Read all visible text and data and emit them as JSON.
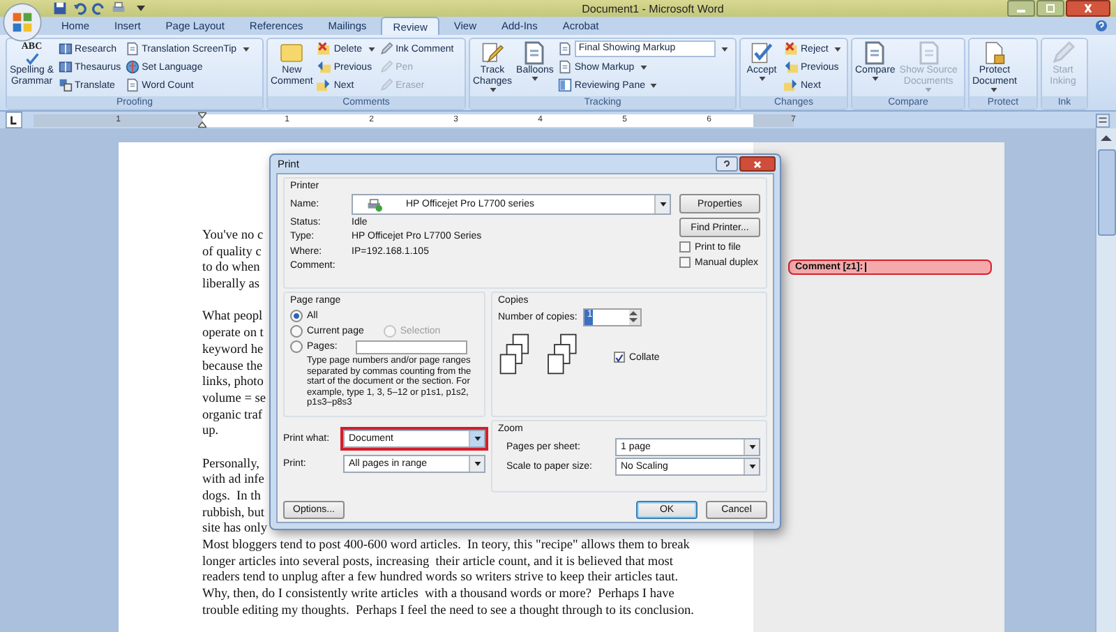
{
  "window": {
    "title": "Document1 - Microsoft Word"
  },
  "tabs": [
    {
      "label": "Home",
      "selected": false
    },
    {
      "label": "Insert",
      "selected": false
    },
    {
      "label": "Page Layout",
      "selected": false
    },
    {
      "label": "References",
      "selected": false
    },
    {
      "label": "Mailings",
      "selected": false
    },
    {
      "label": "Review",
      "selected": true
    },
    {
      "label": "View",
      "selected": false
    },
    {
      "label": "Add-Ins",
      "selected": false
    },
    {
      "label": "Acrobat",
      "selected": false
    }
  ],
  "ribbon": {
    "groups": [
      {
        "label": "Proofing",
        "columns": [
          {
            "kind": "large",
            "label": "Spelling &\nGrammar",
            "icon_text": "ABC",
            "dropdown": false,
            "disabled": false
          },
          {
            "kind": "stack",
            "items": [
              {
                "kind": "button",
                "label": "Research",
                "dropdown": false,
                "disabled": false
              },
              {
                "kind": "button",
                "label": "Thesaurus",
                "dropdown": false,
                "disabled": false
              },
              {
                "kind": "button",
                "label": "Translate",
                "dropdown": false,
                "disabled": false
              }
            ]
          },
          {
            "kind": "stack",
            "items": [
              {
                "kind": "button",
                "label": "Translation ScreenTip",
                "dropdown": true,
                "disabled": false
              },
              {
                "kind": "button",
                "label": "Set Language",
                "dropdown": false,
                "disabled": false
              },
              {
                "kind": "button",
                "label": "Word Count",
                "dropdown": false,
                "disabled": false
              }
            ]
          }
        ]
      },
      {
        "label": "Comments",
        "columns": [
          {
            "kind": "large",
            "label": "New\nComment",
            "dropdown": false,
            "disabled": false
          },
          {
            "kind": "stack",
            "items": [
              {
                "kind": "button",
                "label": "Delete",
                "dropdown": true,
                "disabled": false
              },
              {
                "kind": "button",
                "label": "Previous",
                "dropdown": false,
                "disabled": false
              },
              {
                "kind": "button",
                "label": "Next",
                "dropdown": false,
                "disabled": false
              }
            ]
          },
          {
            "kind": "stack",
            "items": [
              {
                "kind": "button",
                "label": "Ink Comment",
                "dropdown": false,
                "disabled": false
              },
              {
                "kind": "button",
                "label": "Pen",
                "dropdown": false,
                "disabled": true
              },
              {
                "kind": "button",
                "label": "Eraser",
                "dropdown": false,
                "disabled": true
              }
            ]
          }
        ]
      },
      {
        "label": "Tracking",
        "columns": [
          {
            "kind": "large",
            "label": "Track\nChanges",
            "dropdown": true,
            "disabled": false
          },
          {
            "kind": "large",
            "label": "Balloons",
            "dropdown": true,
            "disabled": false
          },
          {
            "kind": "stack",
            "items": [
              {
                "kind": "combo",
                "label": "Final Showing Markup",
                "dropdown": true,
                "disabled": false
              },
              {
                "kind": "button",
                "label": "Show Markup",
                "dropdown": true,
                "disabled": false
              },
              {
                "kind": "button",
                "label": "Reviewing Pane",
                "dropdown": true,
                "disabled": false
              }
            ]
          }
        ]
      },
      {
        "label": "Changes",
        "columns": [
          {
            "kind": "large",
            "label": "Accept",
            "dropdown": true,
            "disabled": false
          },
          {
            "kind": "stack",
            "items": [
              {
                "kind": "button",
                "label": "Reject",
                "dropdown": true,
                "disabled": false
              },
              {
                "kind": "button",
                "label": "Previous",
                "dropdown": false,
                "disabled": false
              },
              {
                "kind": "button",
                "label": "Next",
                "dropdown": false,
                "disabled": false
              }
            ]
          }
        ]
      },
      {
        "label": "Compare",
        "columns": [
          {
            "kind": "large",
            "label": "Compare",
            "dropdown": true,
            "disabled": false
          },
          {
            "kind": "large",
            "label": "Show Source\nDocuments",
            "dropdown": true,
            "disabled": true
          }
        ]
      },
      {
        "label": "Protect",
        "columns": [
          {
            "kind": "large",
            "label": "Protect\nDocument",
            "dropdown": true,
            "disabled": false
          }
        ]
      },
      {
        "label": "Ink",
        "columns": [
          {
            "kind": "large",
            "label": "Start\nInking",
            "dropdown": false,
            "disabled": true
          }
        ]
      }
    ]
  },
  "ruler": {
    "numbers": [
      "1",
      "1",
      "2",
      "3",
      "4",
      "5",
      "6",
      "7"
    ]
  },
  "document": {
    "paragraphs": [
      {
        "lines": [
          "You've no c",
          "of quality c",
          "to do when",
          "liberally as"
        ]
      },
      {
        "lines": [
          "What peopl",
          "operate on t",
          "keyword he",
          "because the",
          "links, photo",
          "volume = se",
          "organic traf",
          "up."
        ]
      },
      {
        "lines": [
          "Personally,",
          "with ad infe",
          "dogs.  In th",
          "rubbish, but",
          "site has only",
          "Most bloggers tend to post 400-600 word articles.  In teory, this \"recipe\" allows them to break",
          "longer articles into several posts, increasing  their article count, and it is believed that most",
          "readers tend to unplug after a few hundred words so writers strive to keep their articles taut.",
          "Why, then, do I consistently write articles  with a thousand words or more?  Perhaps I have",
          "trouble editing my thoughts.  Perhaps I feel the need to see a thought through to its conclusion."
        ]
      }
    ]
  },
  "comment": {
    "label": "Comment [z1]:"
  },
  "print_dialog": {
    "title": "Print",
    "printer": {
      "legend": "Printer",
      "name_label": "Name:",
      "name": "HP Officejet Pro L7700 series",
      "info": [
        {
          "label": "Status:",
          "value": "Idle"
        },
        {
          "label": "Type:",
          "value": "HP Officejet Pro L7700 Series"
        },
        {
          "label": "Where:",
          "value": "IP=192.168.1.105"
        },
        {
          "label": "Comment:"
        }
      ],
      "properties_button": "Properties",
      "find_printer_button": "Find Printer...",
      "options": [
        {
          "label": "Print to file",
          "checked": false
        },
        {
          "label": "Manual duplex",
          "checked": false
        }
      ]
    },
    "page_range": {
      "legend": "Page range",
      "rows": [
        {
          "options": [
            {
              "label": "All",
              "kind": "plain",
              "selected": true,
              "disabled": false
            }
          ]
        },
        {
          "options": [
            {
              "label": "Current page",
              "kind": "plain",
              "selected": false,
              "disabled": false
            },
            {
              "label": "Selection",
              "kind": "plain",
              "selected": false,
              "disabled": true
            }
          ]
        },
        {
          "options": [
            {
              "label": "Pages:",
              "kind": "with_field",
              "selected": false,
              "disabled": false
            }
          ]
        }
      ],
      "hint": "Type page numbers and/or page ranges separated by commas counting from the start of the document or the section. For example, type 1, 3, 5–12 or p1s1, p1s2, p1s3–p8s3"
    },
    "copies": {
      "legend": "Copies",
      "label": "Number of copies:",
      "value": "1",
      "collate": {
        "label": "Collate",
        "checked": true
      }
    },
    "print_what": {
      "label": "Print what:",
      "value": "Document",
      "highlighted": true
    },
    "print": {
      "label": "Print:",
      "value": "All pages in range"
    },
    "zoom": {
      "legend": "Zoom",
      "rows": [
        {
          "label": "Pages per sheet:",
          "value": "1 page"
        },
        {
          "label": "Scale to paper size:",
          "value": "No Scaling"
        }
      ]
    },
    "footer_buttons": [
      {
        "label": "Options...",
        "default": false
      },
      {
        "label": "OK",
        "default": true
      },
      {
        "label": "Cancel",
        "default": false
      }
    ]
  }
}
